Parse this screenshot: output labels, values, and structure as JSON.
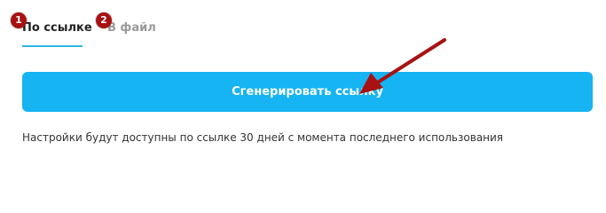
{
  "tabs": [
    {
      "label": "По ссылке",
      "badge": "1",
      "active": true
    },
    {
      "label": "В файл",
      "badge": "2",
      "active": false
    }
  ],
  "generate_button": {
    "label": "Сгенерировать ссылку"
  },
  "note": "Настройки будут доступны по ссылке 30 дней с момента последнего использования",
  "colors": {
    "accent": "#16b4f2",
    "tab_underline": "#2ab7e6",
    "badge": "#a81212",
    "annotation_arrow": "#a81212"
  }
}
